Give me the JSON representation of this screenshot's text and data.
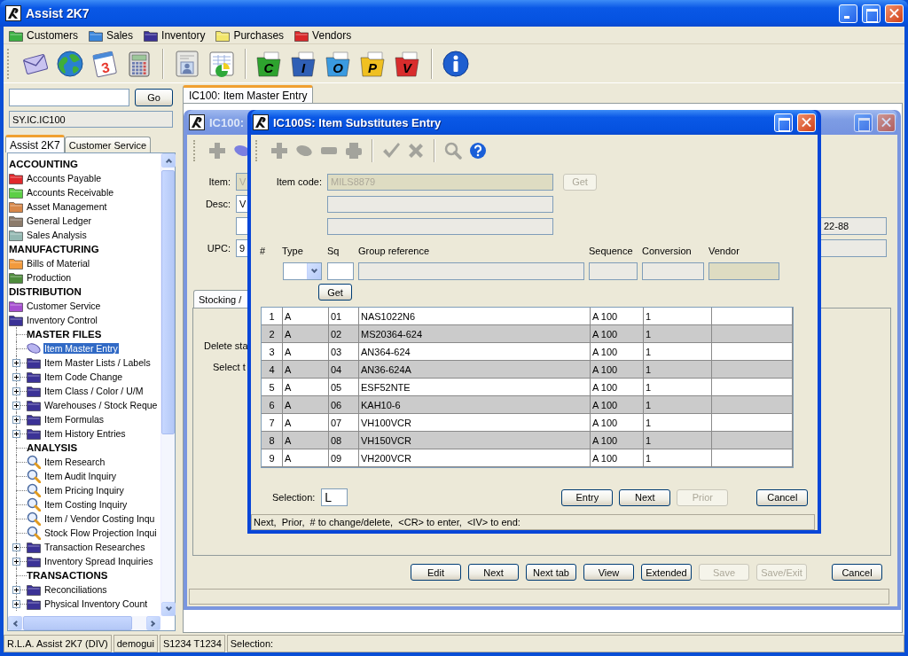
{
  "window": {
    "title": "Assist 2K7"
  },
  "menu": [
    {
      "label": "Customers",
      "color": "#3cb043"
    },
    {
      "label": "Sales",
      "color": "#3a86dc"
    },
    {
      "label": "Inventory",
      "color": "#3b3296"
    },
    {
      "label": "Purchases",
      "color": "#f2e66a"
    },
    {
      "label": "Vendors",
      "color": "#d9282a"
    }
  ],
  "toolbar": [
    [
      {
        "kind": "mail"
      },
      {
        "kind": "globe"
      },
      {
        "kind": "calendar",
        "text": "3"
      },
      {
        "kind": "calculator"
      }
    ],
    [
      {
        "kind": "address-card"
      },
      {
        "kind": "chart"
      }
    ],
    [
      {
        "kind": "letter-folder",
        "text": "C",
        "color": "#2ea32e"
      },
      {
        "kind": "letter-folder",
        "text": "I",
        "color": "#2f5fb5"
      },
      {
        "kind": "letter-folder",
        "text": "O",
        "color": "#3a9ae0"
      },
      {
        "kind": "letter-folder",
        "text": "P",
        "color": "#f0c020"
      },
      {
        "kind": "letter-folder",
        "text": "V",
        "color": "#d82c2c"
      }
    ],
    [
      {
        "kind": "info"
      }
    ]
  ],
  "sidebar": {
    "go_button": "Go",
    "path": "SY.IC.IC100",
    "tabs": [
      {
        "label": "Assist 2K7",
        "selected": true
      },
      {
        "label": "Customer Service",
        "selected": false
      }
    ],
    "tree": [
      {
        "kind": "heading",
        "label": "ACCOUNTING"
      },
      {
        "kind": "folder",
        "label": "Accounts Payable",
        "color": "#e0282c",
        "selected": false
      },
      {
        "kind": "folder",
        "label": "Accounts Receivable",
        "color": "#5ccf46",
        "selected": false
      },
      {
        "kind": "folder",
        "label": "Asset Management",
        "color": "#d8884a",
        "selected": false
      },
      {
        "kind": "folder",
        "label": "General Ledger",
        "color": "#8c7b6b",
        "selected": false
      },
      {
        "kind": "folder",
        "label": "Sales Analysis",
        "color": "#93b8b2",
        "selected": false
      },
      {
        "kind": "heading",
        "label": "MANUFACTURING"
      },
      {
        "kind": "folder",
        "label": "Bills of Material",
        "color": "#f29a3c",
        "selected": false
      },
      {
        "kind": "folder",
        "label": "Production",
        "color": "#4e8c3c",
        "selected": false
      },
      {
        "kind": "heading",
        "label": "DISTRIBUTION"
      },
      {
        "kind": "folder",
        "label": "Customer Service",
        "color": "#a64fd0",
        "selected": false
      },
      {
        "kind": "folder",
        "label": "Inventory Control",
        "color": "#3b3296",
        "selected": false,
        "children": [
          {
            "kind": "heading",
            "label": "MASTER FILES"
          },
          {
            "kind": "entry",
            "label": "Item Master Entry",
            "selected": true
          },
          {
            "kind": "folder",
            "label": "Item Master Lists / Labels",
            "color": "#3b3296",
            "selected": false,
            "expanded": false
          },
          {
            "kind": "folder",
            "label": "Item Code Change",
            "color": "#3b3296",
            "selected": false,
            "expanded": false
          },
          {
            "kind": "folder",
            "label": "Item Class / Color / U/M",
            "color": "#3b3296",
            "selected": false,
            "expanded": false
          },
          {
            "kind": "folder",
            "label": "Warehouses / Stock Reque",
            "color": "#3b3296",
            "selected": false,
            "expanded": false
          },
          {
            "kind": "folder",
            "label": "Item Formulas",
            "color": "#3b3296",
            "selected": false,
            "expanded": false
          },
          {
            "kind": "folder",
            "label": "Item History Entries",
            "color": "#3b3296",
            "selected": false,
            "expanded": false
          },
          {
            "kind": "heading",
            "label": "ANALYSIS"
          },
          {
            "kind": "inquiry",
            "label": "Item Research",
            "selected": false
          },
          {
            "kind": "inquiry",
            "label": "Item Audit Inquiry",
            "selected": false
          },
          {
            "kind": "inquiry",
            "label": "Item Pricing Inquiry",
            "selected": false
          },
          {
            "kind": "inquiry",
            "label": "Item Costing Inquiry",
            "selected": false
          },
          {
            "kind": "inquiry",
            "label": "Item / Vendor Costing Inqu",
            "selected": false
          },
          {
            "kind": "inquiry",
            "label": "Stock Flow Projection Inqui",
            "selected": false
          },
          {
            "kind": "folder",
            "label": "Transaction Researches",
            "color": "#3b3296",
            "selected": false,
            "expanded": false
          },
          {
            "kind": "folder",
            "label": "Inventory Spread Inquiries",
            "color": "#3b3296",
            "selected": false,
            "expanded": false
          },
          {
            "kind": "heading",
            "label": "TRANSACTIONS"
          },
          {
            "kind": "folder",
            "label": "Reconciliations",
            "color": "#3b3296",
            "selected": false,
            "expanded": false
          },
          {
            "kind": "folder",
            "label": "Physical Inventory Count",
            "color": "#3b3296",
            "selected": false,
            "expanded": false
          }
        ]
      }
    ]
  },
  "workspace": {
    "tabs": [
      {
        "label": "IC100: Item Master Entry",
        "selected": true
      }
    ],
    "master": {
      "title": "IC100:",
      "active": false,
      "toolbar": [
        [
          {
            "kind": "add",
            "disabled": true
          },
          {
            "kind": "edit",
            "disabled": false
          }
        ]
      ],
      "rows": [
        {
          "label": "Item:",
          "value": "V",
          "disabled": true,
          "side_field": false
        },
        {
          "label": "Desc:",
          "value": "V",
          "disabled": false,
          "side_field": false
        },
        {
          "disabled": false,
          "side_field": true,
          "side_value": "22-88"
        },
        {
          "label": "UPC:",
          "value": "9",
          "disabled": false,
          "side_field": true
        }
      ],
      "subtabs": [
        {
          "label": "Stocking /",
          "selected": true
        }
      ],
      "panel_texts": [
        "Delete sta",
        "Select t"
      ],
      "buttons": [
        {
          "label": "Edit",
          "disabled": false
        },
        {
          "label": "Next",
          "disabled": false
        },
        {
          "label": "Next tab",
          "disabled": false
        },
        {
          "label": "View",
          "disabled": false
        },
        {
          "label": "Extended",
          "disabled": false
        },
        {
          "label": "Save",
          "disabled": true
        },
        {
          "label": "Save/Exit",
          "disabled": true
        },
        {
          "label": "Cancel",
          "disabled": false
        }
      ]
    },
    "dialog": {
      "title": "IC100S: Item Substitutes Entry",
      "active": true,
      "toolbar": [
        [
          {
            "kind": "add",
            "disabled": true
          },
          {
            "kind": "edit",
            "disabled": true
          },
          {
            "kind": "delete",
            "disabled": true
          },
          {
            "kind": "print",
            "disabled": true
          }
        ],
        [
          {
            "kind": "accept",
            "disabled": true
          },
          {
            "kind": "reject",
            "disabled": true
          }
        ],
        [
          {
            "kind": "search",
            "disabled": true
          },
          {
            "kind": "help",
            "disabled": false
          }
        ]
      ],
      "item_code": {
        "label": "Item code:",
        "value": "MILS8879",
        "disabled": true
      },
      "item_get": {
        "label": "Get",
        "disabled": true
      },
      "description_fields": [
        {
          "readonly": true,
          "disabled": false
        },
        {
          "readonly": true,
          "disabled": false
        }
      ],
      "columns": [
        "#",
        "Type",
        "Sq",
        "Group reference",
        "Sequence",
        "Conversion",
        "Vendor"
      ],
      "entry_row": [
        {
          "kind": "select",
          "disabled": false
        },
        {
          "kind": "text",
          "readonly": false,
          "disabled": false
        },
        {
          "kind": "text",
          "readonly": true,
          "disabled": false
        },
        {
          "kind": "text",
          "readonly": true,
          "disabled": false
        },
        {
          "kind": "text",
          "readonly": true,
          "disabled": false
        },
        {
          "kind": "text",
          "readonly": false,
          "disabled": true
        }
      ],
      "entry_get": {
        "label": "Get",
        "disabled": false
      },
      "rows": [
        [
          "1",
          "A",
          "01",
          "NAS1022N6",
          "A 100",
          "1"
        ],
        [
          "2",
          "A",
          "02",
          "MS20364-624",
          "A 100",
          "1"
        ],
        [
          "3",
          "A",
          "03",
          "AN364-624",
          "A 100",
          "1"
        ],
        [
          "4",
          "A",
          "04",
          "AN36-624A",
          "A 100",
          "1"
        ],
        [
          "5",
          "A",
          "05",
          "ESF52NTE",
          "A 100",
          "1"
        ],
        [
          "6",
          "A",
          "06",
          "KAH10-6",
          "A 100",
          "1"
        ],
        [
          "7",
          "A",
          "07",
          "VH100VCR",
          "A 100",
          "1"
        ],
        [
          "8",
          "A",
          "08",
          "VH150VCR",
          "A 100",
          "1"
        ],
        [
          "9",
          "A",
          "09",
          "VH200VCR",
          "A 100",
          "1"
        ]
      ],
      "selection": {
        "label": "Selection:",
        "value": "L"
      },
      "buttons": [
        {
          "label": "Entry",
          "disabled": false
        },
        {
          "label": "Next",
          "disabled": false
        },
        {
          "label": "Prior",
          "disabled": true
        },
        {
          "label": "Cancel",
          "disabled": false
        }
      ],
      "status": "Next,  Prior,  # to change/delete,  <CR> to enter,  <IV> to end:"
    }
  },
  "status_bar": [
    "R.L.A. Assist 2K7 (DIV)",
    "demogui",
    "S1234 T1234",
    "Selection:"
  ]
}
